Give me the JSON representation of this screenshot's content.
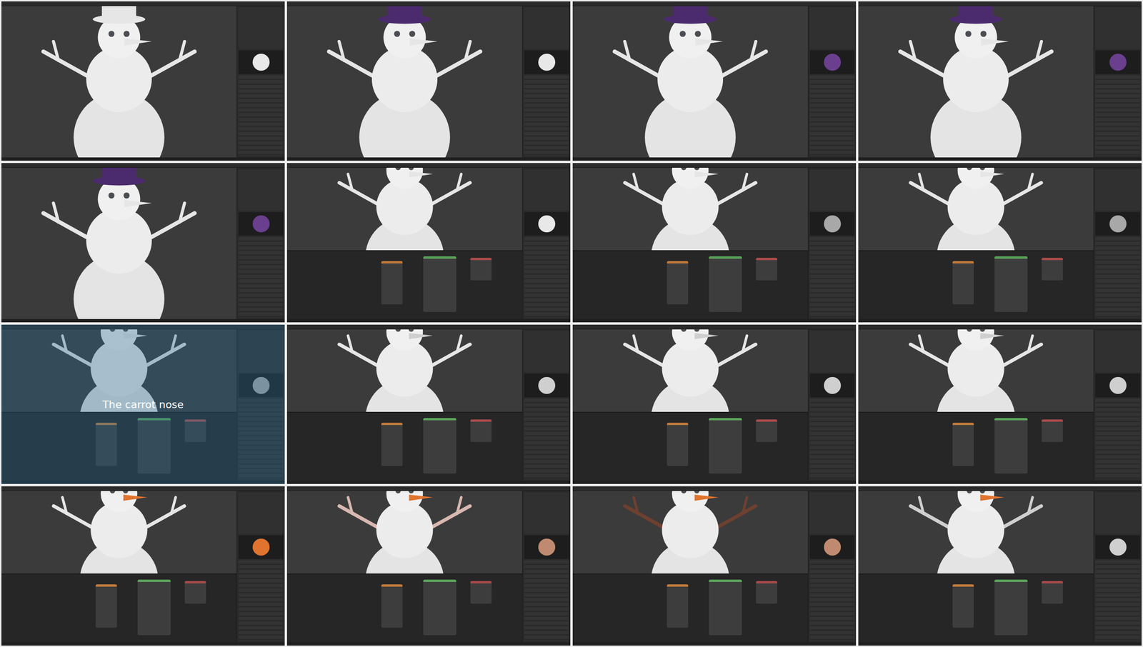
{
  "frames": [
    {
      "kind": "viewport",
      "hat": "#e6e6e6",
      "nose": "#e6e6e6",
      "arms": "#e6e6e6",
      "preview": "#e8e8e8"
    },
    {
      "kind": "viewport",
      "hat": "#4b2a6e",
      "nose": "#e6e6e6",
      "arms": "#e6e6e6",
      "preview": "#e8e8e8"
    },
    {
      "kind": "viewport",
      "hat": "#4b2a6e",
      "nose": "#e6e6e6",
      "arms": "#e6e6e6",
      "preview": "#6a3f8e"
    },
    {
      "kind": "viewport",
      "hat": "#4b2a6e",
      "nose": "#e6e6e6",
      "arms": "#e6e6e6",
      "preview": "#6a3f8e"
    },
    {
      "kind": "viewport",
      "hat": "#4b2a6e",
      "nose": "#e6e6e6",
      "arms": "#e6e6e6",
      "preview": "#6a3f8e"
    },
    {
      "kind": "nodes",
      "hat": "#4b2a6e",
      "nose": "#e6e6e6",
      "arms": "#e6e6e6",
      "preview": "#e8e8e8"
    },
    {
      "kind": "nodes",
      "hat": "#4b2a6e",
      "nose": "#e6e6e6",
      "arms": "#e6e6e6",
      "preview": "#a8a8a8"
    },
    {
      "kind": "nodes",
      "hat": "#4b2a6e",
      "nose": "#e6e6e6",
      "arms": "#e6e6e6",
      "preview": "#a8a8a8"
    },
    {
      "kind": "nodes",
      "hat": "#4b2a6e",
      "nose": "#e6e6e6",
      "arms": "#e6e6e6",
      "preview": "#a8a8a8",
      "caption": "The carrot nose"
    },
    {
      "kind": "nodes",
      "hat": "#4b2a6e",
      "nose": "#cfcfcf",
      "arms": "#e6e6e6",
      "preview": "#cfcfcf"
    },
    {
      "kind": "nodes",
      "hat": "#4b2a6e",
      "nose": "#cfcfcf",
      "arms": "#e6e6e6",
      "preview": "#cfcfcf"
    },
    {
      "kind": "nodes",
      "hat": "#4b2a6e",
      "nose": "#cfcfcf",
      "arms": "#e6e6e6",
      "preview": "#cfcfcf"
    },
    {
      "kind": "nodes",
      "hat": "#4b2a6e",
      "nose": "#e0742e",
      "arms": "#e6e6e6",
      "preview": "#e0742e"
    },
    {
      "kind": "nodes",
      "hat": "#4b2a6e",
      "nose": "#e0742e",
      "arms": "#d8b8b0",
      "preview": "#c08a70"
    },
    {
      "kind": "nodes",
      "hat": "#4b2a6e",
      "nose": "#e0742e",
      "arms": "#6e4030",
      "preview": "#c08a70"
    },
    {
      "kind": "nodes",
      "hat": "#4b2a6e",
      "nose": "#e0742e",
      "arms": "#cfcfcf",
      "preview": "#cfcfcf"
    }
  ]
}
